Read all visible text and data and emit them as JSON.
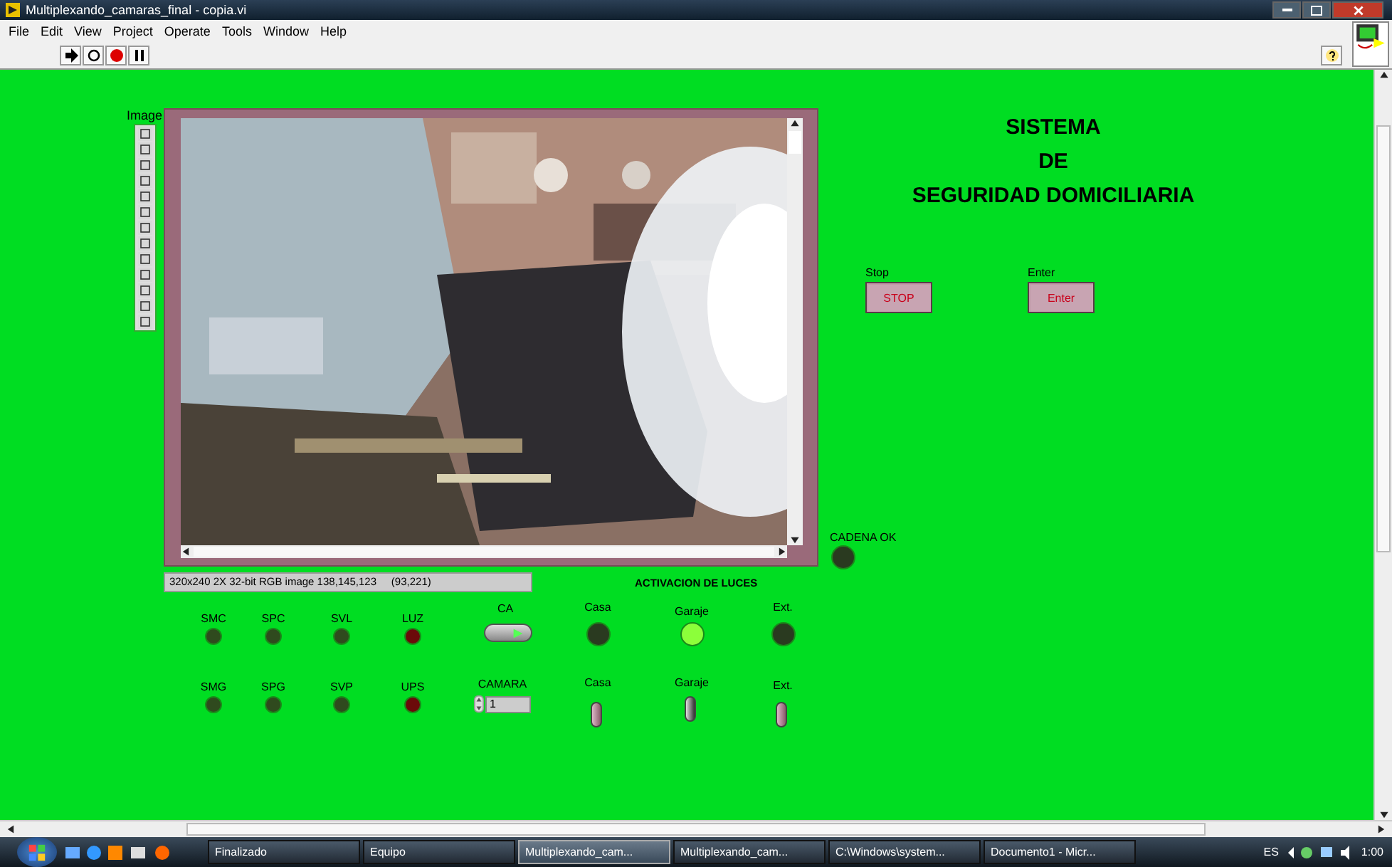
{
  "window": {
    "title": "Multiplexando_camaras_final - copia.vi"
  },
  "menu": [
    "File",
    "Edit",
    "View",
    "Project",
    "Operate",
    "Tools",
    "Window",
    "Help"
  ],
  "panel": {
    "title_lines": [
      "SISTEMA",
      "DE",
      "SEGURIDAD DOMICILIARIA"
    ],
    "image": {
      "label": "Image",
      "info": "320x240 2X 32-bit RGB image 138,145,123     (93,221)"
    },
    "buttons": [
      {
        "label": "Stop",
        "text": "STOP"
      },
      {
        "label": "Enter",
        "text": "Enter"
      }
    ],
    "leds": [
      {
        "label": "SMC",
        "on": false,
        "color": "#2f4a1e"
      },
      {
        "label": "SPC",
        "on": false,
        "color": "#2f4a1e"
      },
      {
        "label": "SVL",
        "on": false,
        "color": "#2f4a1e"
      },
      {
        "label": "LUZ",
        "on": false,
        "color": "#6b0a0a"
      },
      {
        "label": "SMG",
        "on": false,
        "color": "#2f4a1e"
      },
      {
        "label": "SPG",
        "on": false,
        "color": "#2f4a1e"
      },
      {
        "label": "SVP",
        "on": false,
        "color": "#2f4a1e"
      },
      {
        "label": "UPS",
        "on": false,
        "color": "#6b0a0a"
      }
    ],
    "ca": {
      "label": "CA"
    },
    "camara": {
      "label": "CAMARA",
      "value": "1"
    },
    "lights": {
      "title": "ACTIVACION DE LUCES",
      "indicators": [
        {
          "label": "Casa",
          "on": false
        },
        {
          "label": "Garaje",
          "on": true
        },
        {
          "label": "Ext.",
          "on": false
        }
      ],
      "switches": [
        {
          "label": "Casa",
          "on": false
        },
        {
          "label": "Garaje",
          "on": true
        },
        {
          "label": "Ext.",
          "on": false
        }
      ]
    },
    "cadena": {
      "label": "CADENA OK",
      "on": false
    }
  },
  "taskbar": {
    "items": [
      {
        "label": "Finalizado",
        "selected": false
      },
      {
        "label": "Equipo",
        "selected": false
      },
      {
        "label": "Multiplexando_cam...",
        "selected": true
      },
      {
        "label": "Multiplexando_cam...",
        "selected": false
      },
      {
        "label": "C:\\Windows\\system...",
        "selected": false
      },
      {
        "label": "Documento1 - Micr...",
        "selected": false
      }
    ],
    "language": "ES",
    "clock": "1:00"
  }
}
